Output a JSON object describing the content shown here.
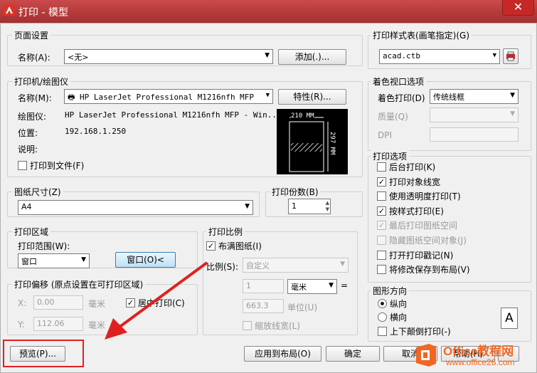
{
  "window": {
    "title": "打印 - 模型",
    "close": "✕"
  },
  "page_setup": {
    "group": "页面设置",
    "name_label": "名称(A):",
    "name_value": "<无>",
    "add_button": "添加(.)..."
  },
  "printer": {
    "group": "打印机/绘图仪",
    "name_label": "名称(M):",
    "name_value": "HP LaserJet Professional M1216nfh MFP",
    "props_button": "特性(R)...",
    "plotter_label": "绘图仪:",
    "plotter_value": "HP LaserJet Professional M1216nfh MFP - Win...",
    "location_label": "位置:",
    "location_value": "192.168.1.250",
    "desc_label": "说明:",
    "print_to_file": "打印到文件(F)",
    "preview_width": "210 MM",
    "preview_height": "297 MM"
  },
  "paper": {
    "group": "图纸尺寸(Z)",
    "value": "A4"
  },
  "copies": {
    "group": "打印份数(B)",
    "value": "1"
  },
  "area": {
    "group": "打印区域",
    "range_label": "打印范围(W):",
    "range_value": "窗口",
    "window_button": "窗口(O)<"
  },
  "offset": {
    "group": "打印偏移 (原点设置在可打印区域)",
    "x_label": "X:",
    "x_value": "0.00",
    "x_unit": "毫米",
    "y_label": "Y:",
    "y_value": "112.06",
    "y_unit": "毫米",
    "center": "居中打印(C)"
  },
  "scale": {
    "group": "打印比例",
    "fit": "布满图纸(I)",
    "scale_label": "比例(S):",
    "scale_value": "自定义",
    "v1": "1",
    "unit": "毫米",
    "eq": "=",
    "v2": "663.3",
    "v2_unit": "单位(U)",
    "lineweights": "缩放线宽(L)"
  },
  "style_table": {
    "group": "打印样式表(画笔指定)(G)",
    "value": "acad.ctb"
  },
  "shaded": {
    "group": "着色视口选项",
    "shade_label": "着色打印(D)",
    "shade_value": "传统线框",
    "quality_label": "质量(Q)",
    "dpi_label": "DPI"
  },
  "options": {
    "group": "打印选项",
    "items": [
      {
        "label": "后台打印(K)",
        "checked": false,
        "disabled": false
      },
      {
        "label": "打印对象线宽",
        "checked": true,
        "disabled": false
      },
      {
        "label": "使用透明度打印(T)",
        "checked": false,
        "disabled": false
      },
      {
        "label": "按样式打印(E)",
        "checked": true,
        "disabled": false
      },
      {
        "label": "最后打印图纸空间",
        "checked": true,
        "disabled": true
      },
      {
        "label": "隐藏图纸空间对象(J)",
        "checked": false,
        "disabled": true
      },
      {
        "label": "打开打印戳记(N)",
        "checked": false,
        "disabled": false
      },
      {
        "label": "将修改保存到布局(V)",
        "checked": false,
        "disabled": false
      }
    ]
  },
  "orientation": {
    "group": "图形方向",
    "portrait": "纵向",
    "landscape": "横向",
    "upside": "上下颠倒打印(-)",
    "icon_letter": "A"
  },
  "footer": {
    "preview": "预览(P)...",
    "apply": "应用到布局(O)",
    "ok": "确定",
    "cancel": "取消",
    "help": "帮助(H)"
  },
  "watermark": {
    "brand": "Office教程网",
    "url": "www.office26.com"
  },
  "colors": {
    "title_bar": "#b83a3a",
    "annotation_red": "#e02020",
    "watermark_orange": "#f26522"
  }
}
